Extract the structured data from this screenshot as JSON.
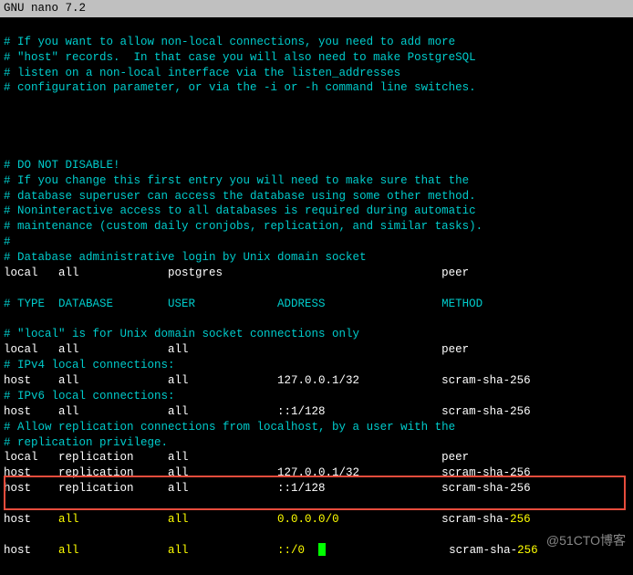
{
  "titlebar": "  GNU nano 7.2",
  "lines": [
    {
      "c": "comment",
      "t": "# If you want to allow non-local connections, you need to add more"
    },
    {
      "c": "comment",
      "t": "# \"host\" records.  In that case you will also need to make PostgreSQL"
    },
    {
      "c": "comment",
      "t": "# listen on a non-local interface via the listen_addresses"
    },
    {
      "c": "comment",
      "t": "# configuration parameter, or via the -i or -h command line switches."
    },
    {
      "c": "comment",
      "t": " "
    },
    {
      "c": "comment",
      "t": " "
    },
    {
      "c": "comment",
      "t": " "
    },
    {
      "c": "comment",
      "t": " "
    },
    {
      "c": "comment",
      "t": "# DO NOT DISABLE!"
    },
    {
      "c": "comment",
      "t": "# If you change this first entry you will need to make sure that the"
    },
    {
      "c": "comment",
      "t": "# database superuser can access the database using some other method."
    },
    {
      "c": "comment",
      "t": "# Noninteractive access to all databases is required during automatic"
    },
    {
      "c": "comment",
      "t": "# maintenance (custom daily cronjobs, replication, and similar tasks)."
    },
    {
      "c": "comment",
      "t": "#"
    },
    {
      "c": "comment",
      "t": "# Database administrative login by Unix domain socket"
    },
    {
      "c": "white",
      "t": "local   all             postgres                                peer"
    },
    {
      "c": "comment",
      "t": " "
    },
    {
      "c": "comment",
      "t": "# TYPE  DATABASE        USER            ADDRESS                 METHOD"
    },
    {
      "c": "comment",
      "t": " "
    },
    {
      "c": "comment",
      "t": "# \"local\" is for Unix domain socket connections only"
    },
    {
      "c": "white",
      "t": "local   all             all                                     peer"
    },
    {
      "c": "comment",
      "t": "# IPv4 local connections:"
    },
    {
      "c": "white",
      "t": "host    all             all             127.0.0.1/32            scram-sha-256"
    },
    {
      "c": "comment",
      "t": "# IPv6 local connections:"
    },
    {
      "c": "white",
      "t": "host    all             all             ::1/128                 scram-sha-256"
    },
    {
      "c": "comment",
      "t": "# Allow replication connections from localhost, by a user with the"
    },
    {
      "c": "comment",
      "t": "# replication privilege."
    },
    {
      "c": "white",
      "t": "local   replication     all                                     peer"
    },
    {
      "c": "white",
      "t": "host    replication     all             127.0.0.1/32            scram-sha-256"
    },
    {
      "c": "white",
      "t": "host    replication     all             ::1/128                 scram-sha-256"
    }
  ],
  "box_lines": {
    "l1_pre": "host    ",
    "l1_y1": "all             all             0.0.0.0/0               ",
    "l1_w": "scram-sha-",
    "l1_y2": "256",
    "l2_pre": "host    ",
    "l2_y1": "all             all             ::/0  ",
    "l2_w": "                  scram-sha-",
    "l2_y2": "256"
  },
  "watermark": "@51CTO博客"
}
